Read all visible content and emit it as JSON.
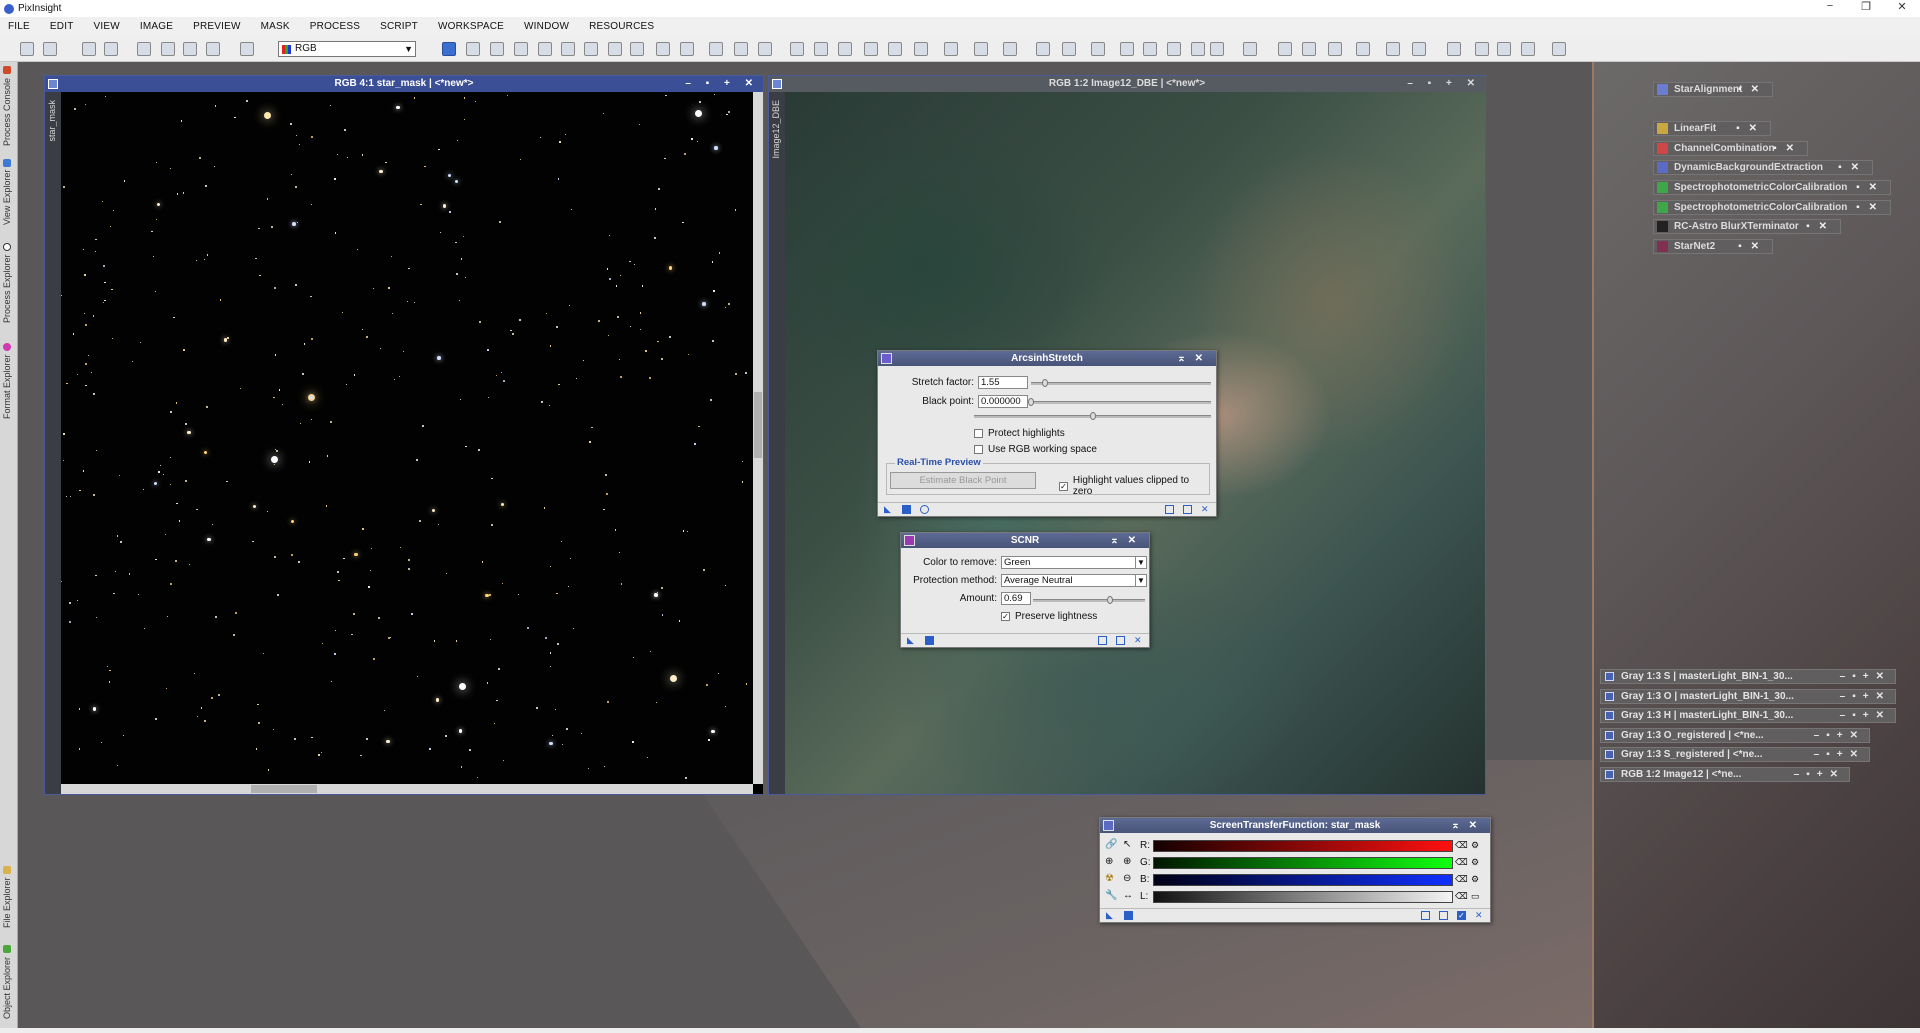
{
  "app": {
    "title": "PixInsight"
  },
  "window_controls": {
    "minimize": "−",
    "restore": "❐",
    "close": "✕"
  },
  "menu": [
    "FILE",
    "EDIT",
    "VIEW",
    "IMAGE",
    "PREVIEW",
    "MASK",
    "PROCESS",
    "SCRIPT",
    "WORKSPACE",
    "WINDOW",
    "RESOURCES"
  ],
  "toolbar": {
    "channel_select": "RGB"
  },
  "left_tabs": [
    "Process Console",
    "View Explorer",
    "Process Explorer",
    "Format Explorer",
    "File Explorer",
    "Object Explorer"
  ],
  "window_star_mask": {
    "title": "RGB 4:1 star_mask | <*new*>",
    "side_label": "star_mask",
    "controls": "– ▪ + ✕"
  },
  "window_image12": {
    "title": "RGB 1:2 Image12_DBE | <*new*>",
    "side_label": "Image12_DBE",
    "controls": "– ▪ + ✕"
  },
  "arcsinh": {
    "title": "ArcsinhStretch",
    "stretch_label": "Stretch factor:",
    "stretch_value": "1.55",
    "stretch_level": 0.08,
    "black_label": "Black point:",
    "black_value": "0.000000",
    "black_level": 0.0,
    "fine_level": 0.5,
    "protect": "Protect highlights",
    "protect_checked": false,
    "rgbws": "Use RGB working space",
    "rgbws_checked": false,
    "rtp": "Real-Time Preview",
    "estimate": "Estimate Black Point",
    "highlight": "Highlight values clipped to zero",
    "highlight_checked": true
  },
  "scnr": {
    "title": "SCNR",
    "color_label": "Color to remove:",
    "color_value": "Green",
    "method_label": "Protection method:",
    "method_value": "Average Neutral",
    "amount_label": "Amount:",
    "amount_value": "0.69",
    "amount_level": 0.69,
    "preserve": "Preserve lightness",
    "preserve_checked": true
  },
  "stf": {
    "title": "ScreenTransferFunction: star_mask",
    "channels": [
      "R:",
      "G:",
      "B:",
      "L:"
    ]
  },
  "process_icons": [
    {
      "label": "StarAlignment",
      "color": "#6a7dd0"
    },
    {
      "label": "LinearFit",
      "color": "#c9a742"
    },
    {
      "label": "ChannelCombination",
      "color": "#d04545"
    },
    {
      "label": "DynamicBackgroundExtraction",
      "color": "#5b6bc4"
    },
    {
      "label": "SpectrophotometricColorCalibration",
      "color": "#3fa64a"
    },
    {
      "label": "SpectrophotometricColorCalibration",
      "color": "#3fa64a"
    },
    {
      "label": "RC-Astro BlurXTerminator",
      "color": "#222222"
    },
    {
      "label": "StarNet2",
      "color": "#803050"
    }
  ],
  "iconified_windows": [
    "Gray 1:3 S | masterLight_BIN-1_30...",
    "Gray 1:3 O | masterLight_BIN-1_30...",
    "Gray 1:3 H | masterLight_BIN-1_30...",
    "Gray 1:3 O_registered | <*ne...",
    "Gray 1:3 S_registered | <*ne...",
    "RGB 1:2 Image12 | <*ne..."
  ]
}
